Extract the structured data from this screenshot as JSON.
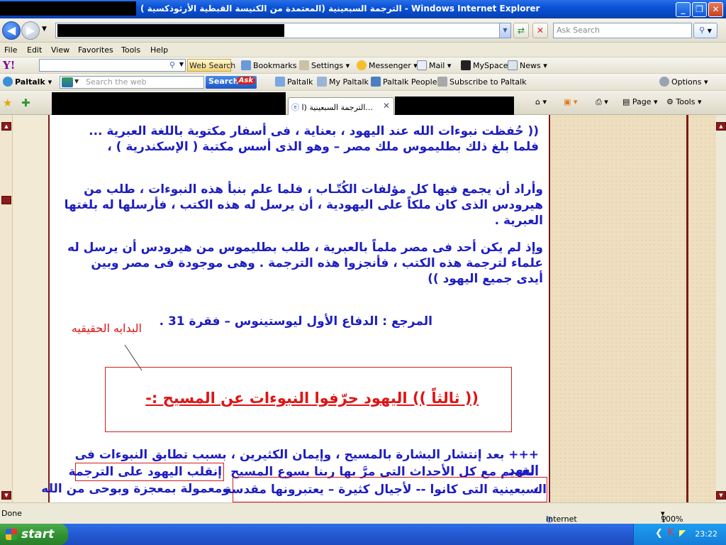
{
  "window": {
    "title": "الترجمة السبعينية (المعتمدة من الكنيسة القبطية الأرثوذكسية ) - Windows Internet Explorer",
    "minimize": "_",
    "maximize": "❐",
    "close": "✕"
  },
  "address": {
    "search_placeholder": "Ask Search"
  },
  "menu": [
    "File",
    "Edit",
    "View",
    "Favorites",
    "Tools",
    "Help"
  ],
  "yahoo_toolbar": {
    "logo": "Y!",
    "web_search": "Web Search",
    "bookmarks": "Bookmarks",
    "settings": "Settings",
    "messenger": "Messenger",
    "mail": "Mail",
    "myspace": "MySpace",
    "news": "News"
  },
  "paltalk_toolbar": {
    "brand": "Paltalk",
    "search_placeholder": "Search the web",
    "search_button": "Search",
    "ask": "Ask",
    "items": [
      "Paltalk",
      "My Paltalk",
      "Paltalk People",
      "Subscribe to Paltalk"
    ],
    "options": "Options"
  },
  "tabs": {
    "active_label": "الترجمة السبعينية (ا...",
    "page": "Page",
    "tools": "Tools"
  },
  "content": {
    "p1": "(( حُفظت نبوءات الله عند اليهود ، بعناية ، فى أسفار مكتوبة باللغة العبرية ... فلما بلغ ذلك بطليموس ملك مصر – وهو الذى أسس مكتبة ( الإسكندرية ) ،",
    "p2": "وأراد أن يجمع فيها كل مؤلفات الكُتّـاب ، فلما علم بنبأ هذه النبوءات ، طلب من هيرودس الذى كان ملكاً على اليهودية ، أن يرسل له هذه الكتب ، فأرسلها له بلغتها العبرية .",
    "p3": "وإذ لم يكن أحد فى مصر ملماً بالعبرية ، طلب بطليموس من هيرودس أن يرسل له علماء لترجمة هذه الكتب ، فأنجزوا هذه الترجمة . وهى موجودة فى مصر وبين أيدى جميع اليهود ))",
    "reference": "المرجع : الدفاع الأول ليوستينوس – فقرة 31 .",
    "annotation": "البدايه الحقيقيه",
    "heading": "(( ثالثاً )) اليهود حرّفوا النبوءات عن المسيح :-",
    "p4_line1": "+++ بعد إنتشار البشارة بالمسيح ، وإيمان الكثيرين ، بسبب تطابق النبوءات فى العهد",
    "p4_line2a": "القديم مع كل الأحداث التى مرَّ بها ربنا يسوع المسيح ،",
    "p4_line2b": "إنقلب اليهود على الترجمة",
    "p4_line3a": "السبعينية التى كانوا -- لأجيال كثيرة – يعتبرونها مقدسة",
    "p4_line3b": "ومعمولة بمعجزة وبوحى من الله"
  },
  "status": {
    "left": "Done",
    "zone": "Internet",
    "zoom": "100%"
  },
  "taskbar": {
    "start": "start",
    "clock": "23:22"
  }
}
